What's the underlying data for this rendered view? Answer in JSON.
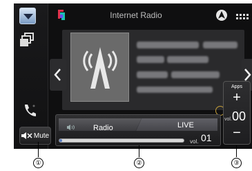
{
  "header": {
    "title": "Internet Radio",
    "app_logo_icon": "app-logo-icon",
    "nav_icon": "navigation-arrow-icon",
    "menu_icon": "menu-dots-icon"
  },
  "left_rail": {
    "dropdown_icon": "chevron-down-icon",
    "windows_icon": "windows-stack-icon",
    "phone_icon": "phone-icon",
    "mute_label": "Mute"
  },
  "source_bar": {
    "tab_radio": "Radio",
    "tab_live": "LIVE",
    "volume_label": "vol.",
    "volume_value": "01",
    "volume_level_fraction": 0.02
  },
  "apps_panel": {
    "label": "Apps",
    "plus": "+",
    "minus": "−",
    "volume_label": "vol.",
    "volume_value": "00"
  },
  "callouts": [
    "①",
    "②",
    "③"
  ],
  "colors": {
    "accent": "#5a7cc0",
    "background": "#0f0f10",
    "panel": "#2a2a2c"
  }
}
